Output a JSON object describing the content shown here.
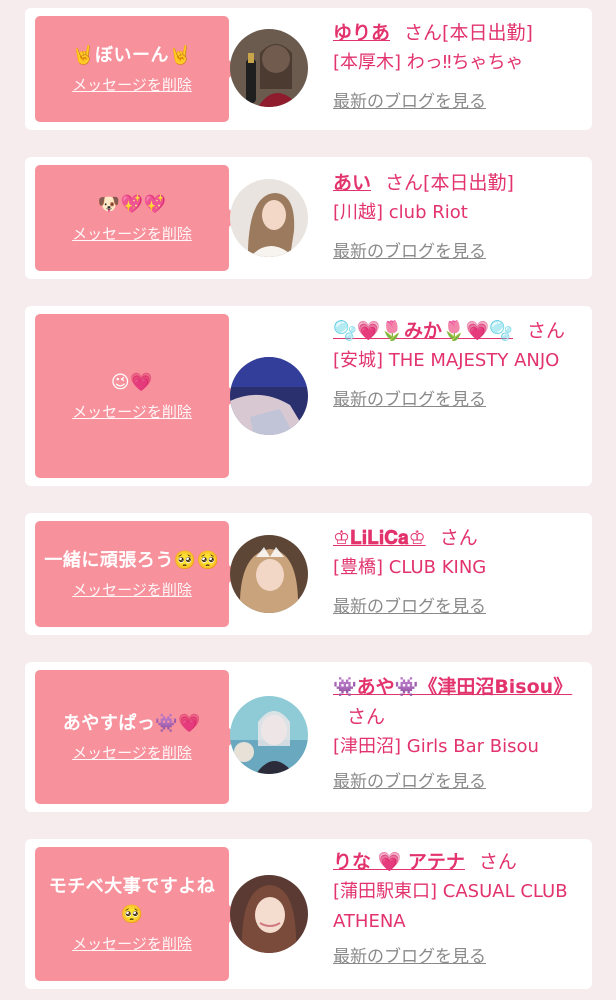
{
  "common": {
    "delete_label": "メッセージを削除",
    "honorific": "さん",
    "blog_label": "最新のブログを見る"
  },
  "colors": {
    "background": "#f6ecee",
    "bubble": "#f7919c",
    "accent_text": "#e2336d",
    "link_gray": "#8a8a8a"
  },
  "messages": [
    {
      "message": "🤘ぼいーん🤘",
      "name": "ゆりあ",
      "status": "[本日出勤]",
      "area": "[本厚木]",
      "shop": "わっ‼ちゃちゃ",
      "avatar_icon": "avatar-photo-icon"
    },
    {
      "message": "🐶💖💖",
      "name": "あい",
      "status": "[本日出勤]",
      "area": "[川越]",
      "shop": "club Riot",
      "avatar_icon": "avatar-photo-icon"
    },
    {
      "message": "😉💗",
      "name": "🫧💗🌷みか🌷💗🫧",
      "status": "",
      "area": "[安城]",
      "shop": "THE MAJESTY ANJO",
      "avatar_icon": "avatar-photo-icon"
    },
    {
      "message": "一緒に頑張ろう🥺🥺",
      "name": "♔𝐋𝐢𝐋𝐢𝐂𝐚♔",
      "status": "",
      "area": "[豊橋]",
      "shop": "CLUB KING",
      "avatar_icon": "avatar-photo-icon"
    },
    {
      "message": "あやすぱっ👾💗",
      "name": "👾あや👾《津田沼Bisou》",
      "status": "",
      "area": "[津田沼]",
      "shop": "Girls Bar Bisou",
      "avatar_icon": "avatar-photo-icon"
    },
    {
      "message": "モチベ大事ですよね🥺",
      "name": "りな 💗 アテナ",
      "status": "",
      "area": "[蒲田駅東口]",
      "shop": "CASUAL CLUB ATHENA",
      "avatar_icon": "avatar-photo-icon"
    }
  ]
}
